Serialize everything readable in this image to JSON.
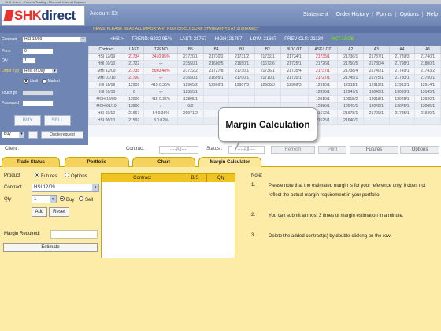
{
  "window": {
    "title": "SHK Online - Futures Trading - Microsoft Internet Explorer"
  },
  "header": {
    "logo": "SHKdirect",
    "account_label": "Account ID:",
    "nav": [
      "Statement",
      "Order History",
      "Forms",
      "Options",
      "Help"
    ],
    "ticker": "NEWS: PLEASE READ ALL IMPORTANT RISK DISCLOSURE STATEMENTS AT SHKDIRECT"
  },
  "order_panel": {
    "contract_label": "Contract",
    "contract_value": "HSI 12/09",
    "price_label": "Price",
    "price_value": "0",
    "qty_label": "Qty",
    "qty_value": "1",
    "order_type_label": "Order Typ",
    "order_type_value": "Rest of Day",
    "limit_label": "Limit",
    "market_label": "Market",
    "touch_label": "Touch pri",
    "password_label": "Password",
    "buy_label": "BUY",
    "sell_label": "SELL",
    "side_value": "Buy",
    "quote_label": "Quote request"
  },
  "market": {
    "code": "<HSI>",
    "trend_label": "TREND:",
    "trend_value": "6232 95%",
    "last_label": "LAST:",
    "last_value": "21757",
    "high_label": "HIGH:",
    "high_value": "21787",
    "low_label": "LOW:",
    "low_value": "21697",
    "prev_label": "PREV CLS:",
    "prev_value": "21134",
    "time": "HKT 10:36",
    "columns": [
      "Contract",
      "LAST",
      "TREND",
      "B5",
      "B4",
      "B3",
      "B2",
      "BID/LOT",
      "ASK/LOT",
      "A2",
      "A3",
      "A4",
      "A5"
    ],
    "rows": [
      [
        "HSI 12/09",
        "21734",
        "3410 95%",
        "21720/1",
        "21730/2",
        "21731/2",
        "21732/1",
        "21734/1",
        "21735/1",
        "21736/1",
        "21737/1",
        "21739/3",
        "21740/1"
      ],
      [
        "HHI 01/10",
        "21722",
        "-/-",
        "21550/1",
        "21600/5",
        "21650/1",
        "21672/6",
        "21725/1",
        "21726/1",
        "21750/5",
        "21780/4",
        "21798/1",
        "21800/1"
      ],
      [
        "MHI 12/09",
        "21735",
        "5690 48%",
        "21722/2",
        "21727/8",
        "21730/1",
        "21736/1",
        "21735/4",
        "21737/1",
        "21738/4",
        "21740/1",
        "21749/1",
        "21743/2"
      ],
      [
        "MHI 01/10",
        "21720",
        "-/-",
        "21650/1",
        "21695/1",
        "21700/1",
        "21710/1",
        "21720/1",
        "21727/1",
        "21745/1",
        "21775/1",
        "21780/1",
        "21750/1"
      ],
      [
        "HHI 12/09",
        "12909",
        "415 0.35%",
        "12905/2",
        "12906/1",
        "12907/3",
        "12908/3",
        "12909/3",
        "12910/1",
        "12911/1",
        "12912/1",
        "12913/1",
        "12914/1"
      ],
      [
        "HHI 01/10",
        "0",
        "-/-",
        "12555/1",
        "",
        "",
        "",
        "",
        "12896/1",
        "12947/1",
        "13043/1",
        "13093/1",
        "13145/1"
      ],
      [
        "MCH 12/09",
        "12909",
        "415 0.35%",
        "12895/1",
        "",
        "",
        "",
        "",
        "12910/1",
        "12915/2",
        "12918/1",
        "12928/1",
        "12930/1"
      ],
      [
        "MCH 01/10",
        "12900",
        "-/-",
        "0/0",
        "",
        "",
        "",
        "",
        "12880/1",
        "12949/1",
        "13049/1",
        "13075/1",
        "12995/1"
      ],
      [
        "HSI 03/10",
        "21667",
        "54 0.36%",
        "20971/2",
        "",
        "",
        "",
        "",
        "21672/1",
        "21678/1",
        "21700/1",
        "21785/1",
        "21939/1"
      ],
      [
        "HSI 06/10",
        "21597",
        "3 0.02%",
        "",
        "",
        "",
        "",
        "",
        "21625/1",
        "21640/1",
        "",
        "",
        ""
      ]
    ]
  },
  "toolbar": {
    "client_label": "Client :",
    "contract_label": "Contract :",
    "contract_value": "----All----",
    "status_label": "Status :",
    "status_value": "----All----",
    "refresh_label": "Refresh",
    "print_label": "Print",
    "futures_label": "Futures",
    "options_label": "Options"
  },
  "tabs": [
    "Trade Status",
    "Portfolio",
    "Chart",
    "Margin Calculator"
  ],
  "calculator": {
    "product_label": "Product",
    "futures_label": "Futures",
    "options_label": "Options",
    "contract_label": "Contract",
    "contract_value": "HSI 12/09",
    "qty_label": "Qty",
    "qty_value": "1",
    "buy_label": "Buy",
    "sell_label": "Sell",
    "add_label": "Add",
    "reset_label": "Reset",
    "margin_required_label": "Margin Required:",
    "estimate_label": "Estimate",
    "table_columns": [
      "Contract",
      "B/S",
      "Qty"
    ],
    "note_title": "Note:",
    "notes": [
      {
        "num": "1.",
        "text": "Please note that the estimated margin is for your reference only, it does not reflect the actual margin requirement in your portfolio."
      },
      {
        "num": "2.",
        "text": "You can submit at most 3 times of margin estimation in a minute."
      },
      {
        "num": "3.",
        "text": "Delete the added contract(s) by double-clicking on the row."
      }
    ]
  },
  "callout": {
    "text": "Margin Calculation"
  },
  "colors": {
    "tab_active": "#fbe89a",
    "tab": "#f5d25b",
    "panel": "#fdeca8",
    "header": "#6f86b4",
    "logo_red": "#e8322e"
  }
}
